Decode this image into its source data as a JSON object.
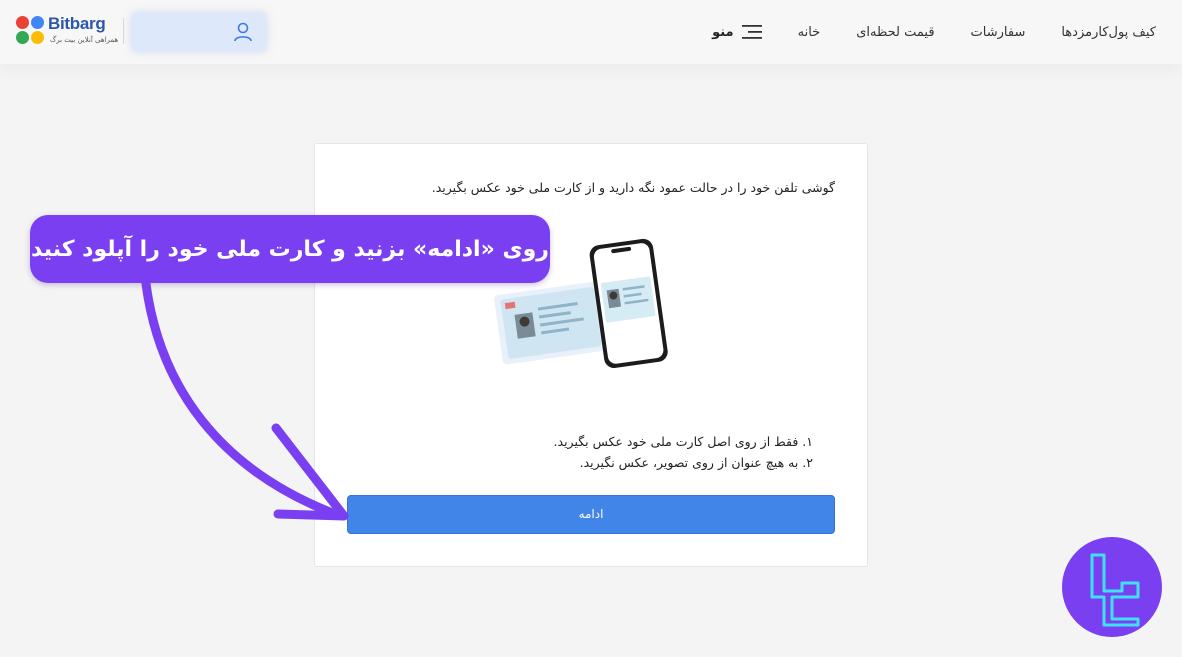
{
  "header": {
    "logo": {
      "word": "Bitbarg",
      "tagline": "همراهی آنلاین بیت برگ"
    },
    "nav": {
      "menu_label": "منو",
      "items": [
        "خانه",
        "قیمت لحظه‌ای",
        "سفارشات",
        "کارمزدها",
        "کیف پول"
      ]
    }
  },
  "card": {
    "instruction": "گوشی تلفن خود را در حالت عمود نگه دارید و از کارت ملی خود عکس بگیرید.",
    "rules": [
      "۱. فقط از روی اصل کارت ملی خود عکس بگیرید.",
      "۲. به هیچ عنوان از روی تصویر، عکس نگیرید."
    ],
    "continue_label": "ادامه"
  },
  "callout": {
    "text": "روی «ادامه» بزنید و کارت ملی خود را آپلود کنید"
  },
  "colors": {
    "accent_blue": "#4285e8",
    "callout_purple": "#7b3ff2",
    "badge_cyan": "#3fe0f0"
  },
  "icons": [
    "user-icon",
    "hamburger-menu-icon",
    "id-card-phone-illustration",
    "arrow-pointer",
    "brand-badge-icon"
  ]
}
